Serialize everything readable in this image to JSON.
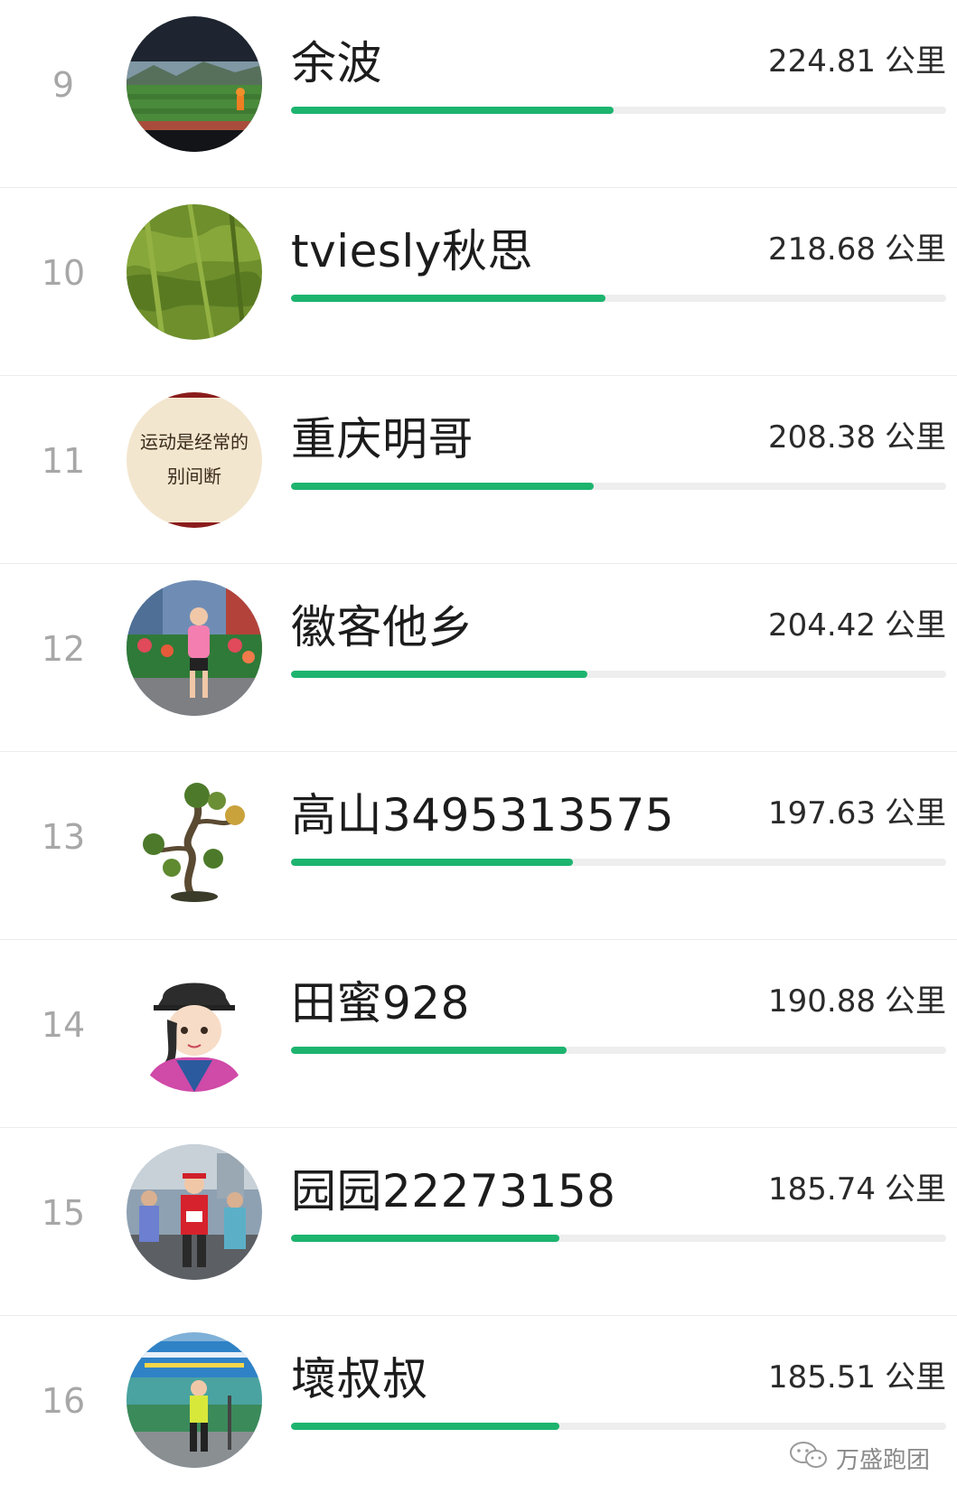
{
  "leaderboard": {
    "unit": "公里",
    "rows": [
      {
        "rank": "9",
        "name": "余波",
        "distance": "224.81",
        "progress": 0.492,
        "avatar_icon": "stadium-track-photo-icon"
      },
      {
        "rank": "10",
        "name": "tviesly秋思",
        "distance": "218.68",
        "progress": 0.48,
        "avatar_icon": "moss-texture-photo-icon"
      },
      {
        "rank": "11",
        "name": "重庆明哥",
        "distance": "208.38",
        "progress": 0.462,
        "avatar_icon": "calligraphy-text-avatar-icon",
        "avatar_text_line1": "运动是经常的",
        "avatar_text_line2": "别间断"
      },
      {
        "rank": "12",
        "name": "徽客他乡",
        "distance": "204.42",
        "progress": 0.452,
        "avatar_icon": "runner-photo-icon"
      },
      {
        "rank": "13",
        "name": "高山3495313575",
        "distance": "197.63",
        "progress": 0.431,
        "avatar_icon": "bonsai-tree-icon"
      },
      {
        "rank": "14",
        "name": "田蜜928",
        "distance": "190.88",
        "progress": 0.421,
        "avatar_icon": "cartoon-girl-avatar-icon"
      },
      {
        "rank": "15",
        "name": "园园22273158",
        "distance": "185.74",
        "progress": 0.41,
        "avatar_icon": "marathon-crowd-photo-icon"
      },
      {
        "rank": "16",
        "name": "壞叔叔",
        "distance": "185.51",
        "progress": 0.41,
        "avatar_icon": "runner-banner-photo-icon"
      }
    ]
  },
  "watermark": {
    "text": "万盛跑团",
    "icon": "wechat-icon"
  },
  "colors": {
    "progress_fill": "#1db46f",
    "progress_track": "#eeeeee",
    "rank_text": "#a7a7a7"
  }
}
